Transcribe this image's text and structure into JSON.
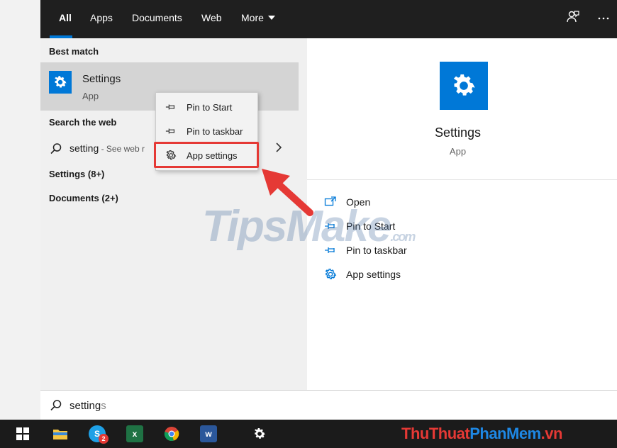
{
  "top_tabs": [
    "All",
    "Apps",
    "Documents",
    "Web",
    "More"
  ],
  "best_match": {
    "section_label": "Best match",
    "title": "Settings",
    "subtitle": "App"
  },
  "search_web": {
    "section_label": "Search the web",
    "query": "setting",
    "hint": " - See web r"
  },
  "groups": [
    "Settings (8+)",
    "Documents (2+)"
  ],
  "context_menu": [
    "Pin to Start",
    "Pin to taskbar",
    "App settings"
  ],
  "right_panel": {
    "title": "Settings",
    "subtitle": "App",
    "actions": [
      "Open",
      "Pin to Start",
      "Pin to taskbar",
      "App settings"
    ]
  },
  "watermark": {
    "main": "TipsMake",
    "suffix": ".com"
  },
  "search": {
    "typed": "setting",
    "ghost": "s"
  },
  "taskbar": {
    "skype_badge": "2",
    "excel_label": "x",
    "word_label": "w"
  },
  "brand": {
    "part1": "ThuThuat",
    "part2": "PhanMem",
    "part3": ".vn"
  },
  "colors": {
    "accent": "#0078d7",
    "highlight": "#e53935",
    "brand1": "#e53935",
    "brand2": "#1e88e5"
  }
}
